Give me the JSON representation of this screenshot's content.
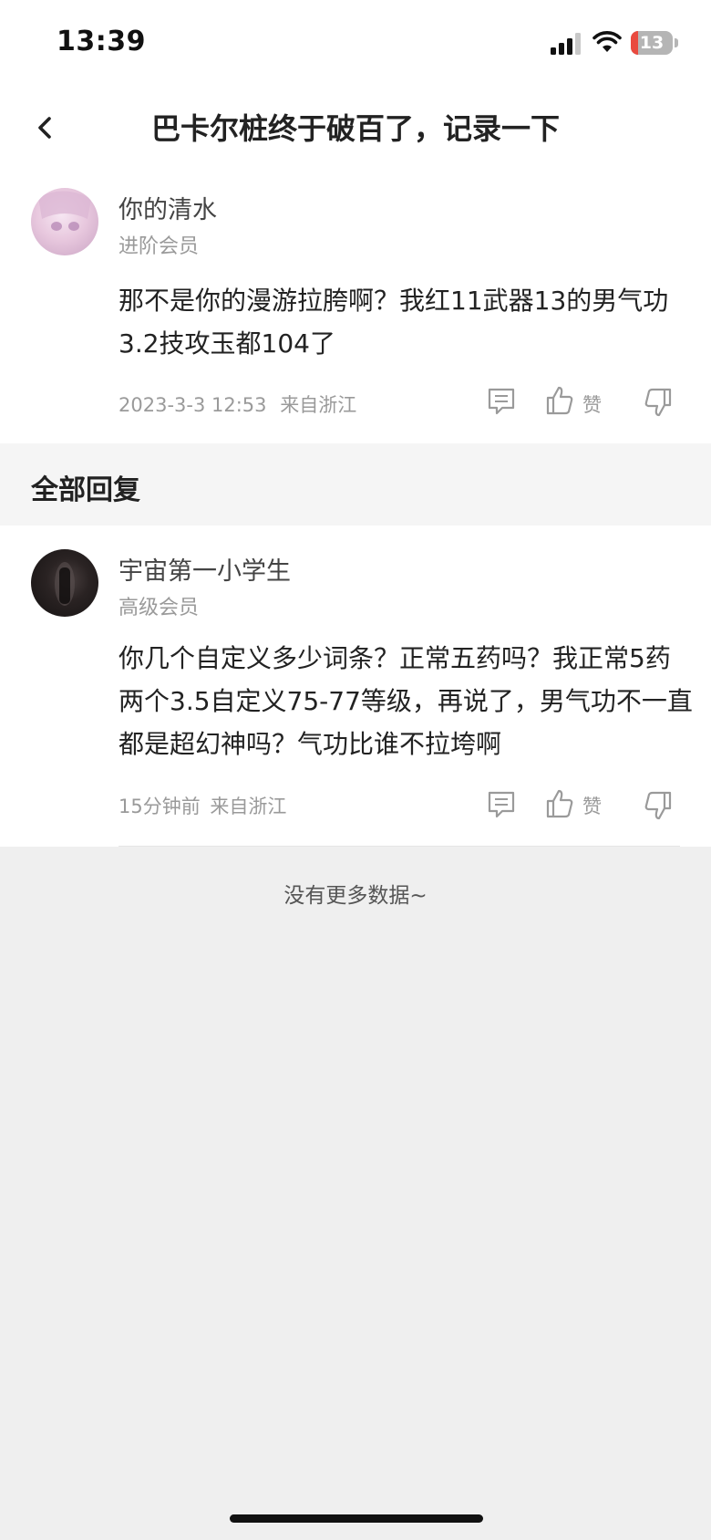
{
  "status_bar": {
    "time": "13:39",
    "battery": "13"
  },
  "nav": {
    "title": "巴卡尔桩终于破百了，记录一下"
  },
  "main_comment": {
    "username": "你的清水",
    "level": "进阶会员",
    "content": "那不是你的漫游拉胯啊？我红11武器13的男气功3.2技攻玉都104了",
    "timestamp": "2023-3-3 12:53",
    "location": "来自浙江",
    "like_label": "赞"
  },
  "replies_section": {
    "title": "全部回复"
  },
  "replies": [
    {
      "username": "宇宙第一小学生",
      "level": "高级会员",
      "content": "你几个自定义多少词条？正常五药吗？我正常5药两个3.5自定义75-77等级，再说了，男气功不一直都是超幻神吗？气功比谁不拉垮啊",
      "timestamp": "15分钟前",
      "location": "来自浙江",
      "like_label": "赞"
    }
  ],
  "footer": {
    "no_more": "没有更多数据~"
  },
  "icons": [
    "back-icon",
    "signal-icon",
    "wifi-icon",
    "battery-icon",
    "comment-icon",
    "thumbs-up-icon",
    "thumbs-down-icon"
  ],
  "colors": {
    "battery_low": "#e94a3f",
    "secondary_text": "#9a9a9a",
    "background": "#efefef"
  }
}
